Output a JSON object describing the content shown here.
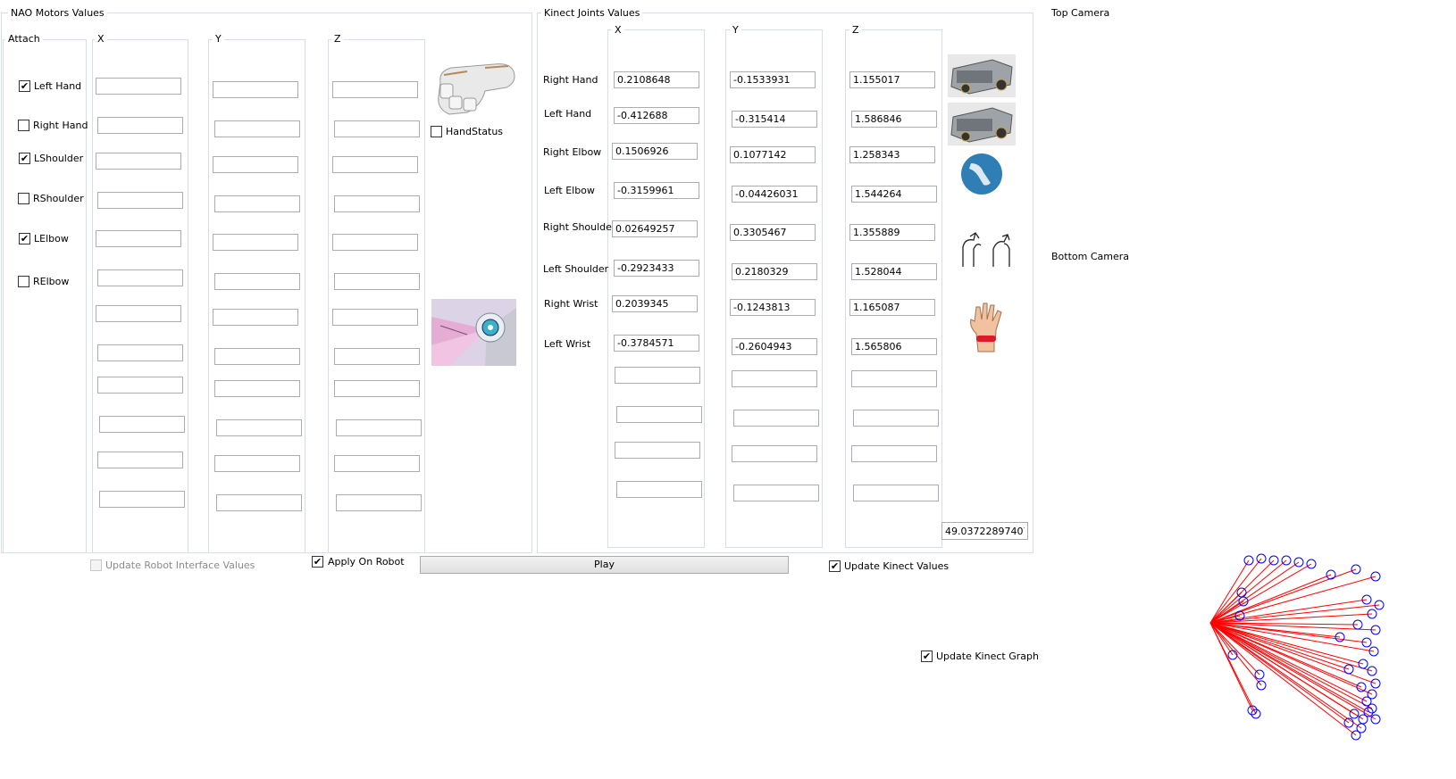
{
  "nao": {
    "title": "NAO Motors Values",
    "attach_header": "Attach",
    "col_x": "X",
    "col_y": "Y",
    "col_z": "Z",
    "checkboxes": [
      {
        "label": "Left Hand",
        "checked": true
      },
      {
        "label": "Right Hand",
        "checked": false
      },
      {
        "label": "LShoulder",
        "checked": true
      },
      {
        "label": "RShoulder",
        "checked": false
      },
      {
        "label": "LElbow",
        "checked": true
      },
      {
        "label": "RElbow",
        "checked": false
      }
    ],
    "hand_status_label": "HandStatus",
    "hand_status_checked": false
  },
  "kinect": {
    "title": "Kinect Joints Values",
    "col_x": "X",
    "col_y": "Y",
    "col_z": "Z",
    "joints": [
      {
        "label": "Right Hand",
        "x": "0.2108648",
        "y": "-0.1533931",
        "z": "1.155017"
      },
      {
        "label": "Left Hand",
        "x": "-0.412688",
        "y": "-0.315414",
        "z": "1.586846"
      },
      {
        "label": "Right Elbow",
        "x": "0.1506926",
        "y": "0.1077142",
        "z": "1.258343"
      },
      {
        "label": "Left Elbow",
        "x": "-0.3159961",
        "y": "-0.04426031",
        "z": "1.544264"
      },
      {
        "label": "Right Shoulder",
        "x": "0.02649257",
        "y": "0.3305467",
        "z": "1.355889"
      },
      {
        "label": "Left Shoulder",
        "x": "-0.2923433",
        "y": "0.2180329",
        "z": "1.528044"
      },
      {
        "label": "Right Wrist",
        "x": "0.2039345",
        "y": "-0.1243813",
        "z": "1.165087"
      },
      {
        "label": "Left Wrist",
        "x": "-0.3784571",
        "y": "-0.2604943",
        "z": "1.565806"
      }
    ],
    "angle_value": "49.037228974071"
  },
  "cameras": {
    "top": "Top Camera",
    "bottom": "Bottom Camera"
  },
  "controls": {
    "update_robot_interface": {
      "label": "Update Robot Interface Values",
      "checked": false,
      "enabled": false
    },
    "apply_on_robot": {
      "label": "Apply On Robot",
      "checked": true
    },
    "play_button": "Play",
    "update_kinect_values": {
      "label": "Update Kinect Values",
      "checked": true
    },
    "update_kinect_graph": {
      "label": "Update Kinect Graph",
      "checked": true
    }
  },
  "colors": {
    "skeleton_lines": "#ff0000",
    "skeleton_joints": "#0000ff",
    "groupbox_border": "#d5dfe5"
  },
  "icons": [
    "robot-hand-icon",
    "robot-arm-icon",
    "kinect-sensor-icon",
    "elbow-icon",
    "shoulders-icon",
    "wrist-icon"
  ]
}
